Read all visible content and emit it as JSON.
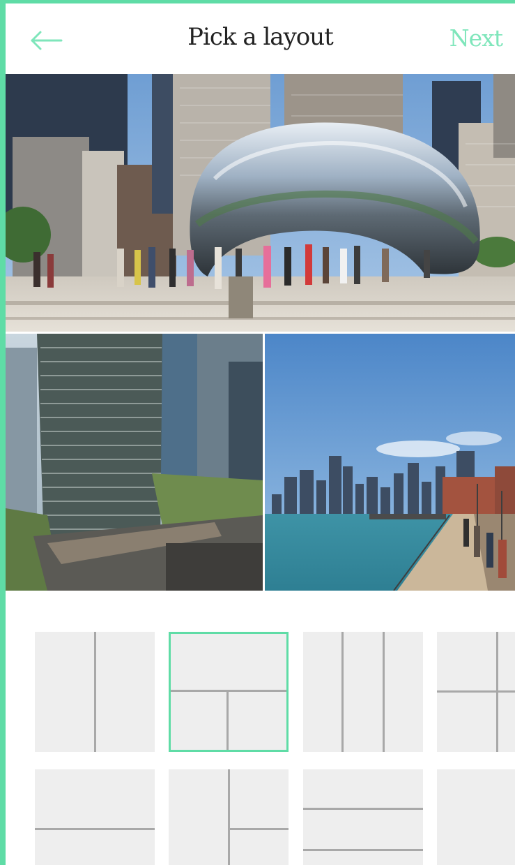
{
  "header": {
    "back_icon": "left-arrow-icon",
    "title": "Pick a layout",
    "next_label": "Next"
  },
  "colors": {
    "accent": "#5fdca6",
    "next_text": "#7fe6bb",
    "thumb_bg": "#eeeeee",
    "thumb_line": "#a8a8a8"
  },
  "collage": {
    "photos": [
      {
        "subject": "Cloud Gate sculpture with city buildings and crowd"
      },
      {
        "subject": "Glass high-rise tower beside river"
      },
      {
        "subject": "Lakefront pier with city skyline"
      }
    ]
  },
  "layouts": {
    "selected_index": 1,
    "options": [
      {
        "name": "two-columns"
      },
      {
        "name": "one-top-two-bottom"
      },
      {
        "name": "three-columns"
      },
      {
        "name": "four-grid"
      },
      {
        "name": "two-rows"
      },
      {
        "name": "left-column-right-split"
      },
      {
        "name": "three-rows"
      },
      {
        "name": "single"
      }
    ]
  }
}
